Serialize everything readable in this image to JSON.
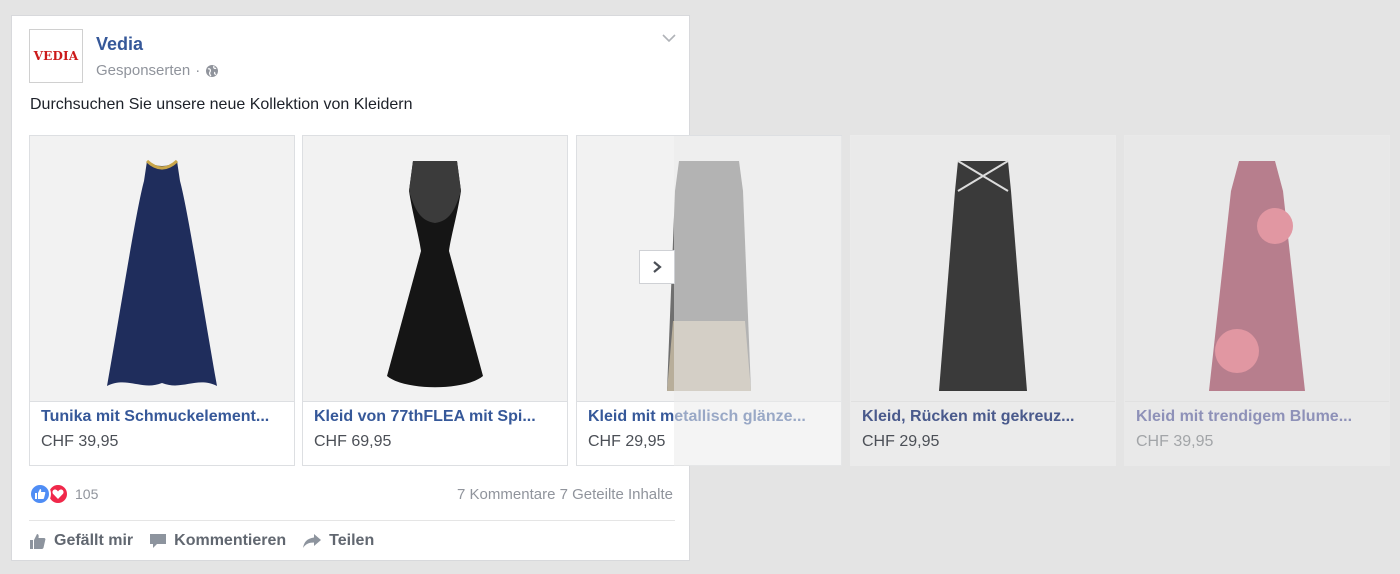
{
  "post": {
    "page_name": "Vedia",
    "logo_text": "VEDIA",
    "sponsored": "Gesponserten",
    "separator": "·",
    "text": "Durchsuchen Sie unsere neue Kollektion von Kleidern"
  },
  "cards": [
    {
      "title": "Tunika mit Schmuckelement...",
      "price": "CHF 39,95",
      "dress_color": "#1f2d5c"
    },
    {
      "title": "Kleid von 77thFLEA mit Spi...",
      "price": "CHF 69,95",
      "dress_color": "#151515"
    },
    {
      "title": "Kleid mit metallisch glänze...",
      "price": "CHF 29,95",
      "dress_color": "#7a7a7a"
    },
    {
      "title": "Kleid, Rücken mit gekreuz...",
      "price": "CHF 29,95",
      "dress_color": "#3a3a3a"
    },
    {
      "title": "Kleid mit trendigem Blume...",
      "price": "CHF 39,95",
      "dress_color": "#a7586c"
    }
  ],
  "engagement": {
    "reaction_count": "105",
    "comments_shares": "7 Kommentare 7 Geteilte Inhalte"
  },
  "actions": {
    "like": "Gefällt mir",
    "comment": "Kommentieren",
    "share": "Teilen"
  },
  "icons": {
    "chevron": "chevron-down-icon",
    "globe": "globe-icon",
    "next": "chevron-right-icon"
  },
  "colors": {
    "link_blue": "#365899",
    "like_blue": "#4f8df5",
    "love_red": "#f0284a"
  }
}
